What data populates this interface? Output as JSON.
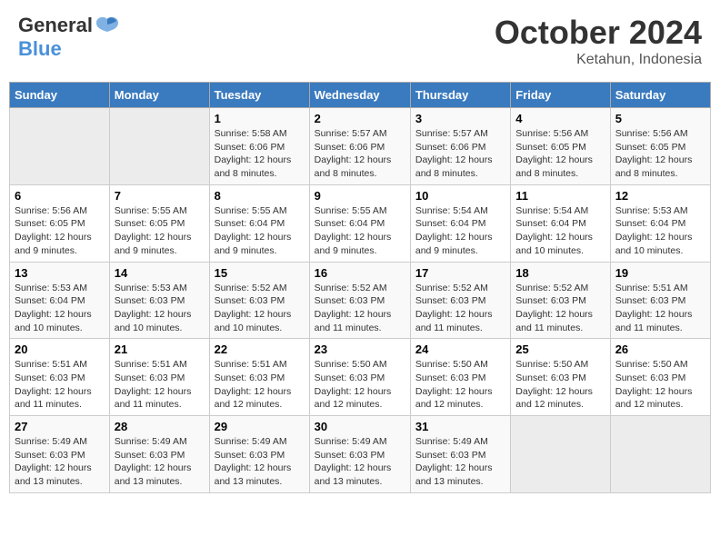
{
  "header": {
    "logo_general": "General",
    "logo_blue": "Blue",
    "month": "October 2024",
    "location": "Ketahun, Indonesia"
  },
  "weekdays": [
    "Sunday",
    "Monday",
    "Tuesday",
    "Wednesday",
    "Thursday",
    "Friday",
    "Saturday"
  ],
  "weeks": [
    [
      {
        "day": "",
        "sunrise": "",
        "sunset": "",
        "daylight": ""
      },
      {
        "day": "",
        "sunrise": "",
        "sunset": "",
        "daylight": ""
      },
      {
        "day": "1",
        "sunrise": "Sunrise: 5:58 AM",
        "sunset": "Sunset: 6:06 PM",
        "daylight": "Daylight: 12 hours and 8 minutes."
      },
      {
        "day": "2",
        "sunrise": "Sunrise: 5:57 AM",
        "sunset": "Sunset: 6:06 PM",
        "daylight": "Daylight: 12 hours and 8 minutes."
      },
      {
        "day": "3",
        "sunrise": "Sunrise: 5:57 AM",
        "sunset": "Sunset: 6:06 PM",
        "daylight": "Daylight: 12 hours and 8 minutes."
      },
      {
        "day": "4",
        "sunrise": "Sunrise: 5:56 AM",
        "sunset": "Sunset: 6:05 PM",
        "daylight": "Daylight: 12 hours and 8 minutes."
      },
      {
        "day": "5",
        "sunrise": "Sunrise: 5:56 AM",
        "sunset": "Sunset: 6:05 PM",
        "daylight": "Daylight: 12 hours and 8 minutes."
      }
    ],
    [
      {
        "day": "6",
        "sunrise": "Sunrise: 5:56 AM",
        "sunset": "Sunset: 6:05 PM",
        "daylight": "Daylight: 12 hours and 9 minutes."
      },
      {
        "day": "7",
        "sunrise": "Sunrise: 5:55 AM",
        "sunset": "Sunset: 6:05 PM",
        "daylight": "Daylight: 12 hours and 9 minutes."
      },
      {
        "day": "8",
        "sunrise": "Sunrise: 5:55 AM",
        "sunset": "Sunset: 6:04 PM",
        "daylight": "Daylight: 12 hours and 9 minutes."
      },
      {
        "day": "9",
        "sunrise": "Sunrise: 5:55 AM",
        "sunset": "Sunset: 6:04 PM",
        "daylight": "Daylight: 12 hours and 9 minutes."
      },
      {
        "day": "10",
        "sunrise": "Sunrise: 5:54 AM",
        "sunset": "Sunset: 6:04 PM",
        "daylight": "Daylight: 12 hours and 9 minutes."
      },
      {
        "day": "11",
        "sunrise": "Sunrise: 5:54 AM",
        "sunset": "Sunset: 6:04 PM",
        "daylight": "Daylight: 12 hours and 10 minutes."
      },
      {
        "day": "12",
        "sunrise": "Sunrise: 5:53 AM",
        "sunset": "Sunset: 6:04 PM",
        "daylight": "Daylight: 12 hours and 10 minutes."
      }
    ],
    [
      {
        "day": "13",
        "sunrise": "Sunrise: 5:53 AM",
        "sunset": "Sunset: 6:04 PM",
        "daylight": "Daylight: 12 hours and 10 minutes."
      },
      {
        "day": "14",
        "sunrise": "Sunrise: 5:53 AM",
        "sunset": "Sunset: 6:03 PM",
        "daylight": "Daylight: 12 hours and 10 minutes."
      },
      {
        "day": "15",
        "sunrise": "Sunrise: 5:52 AM",
        "sunset": "Sunset: 6:03 PM",
        "daylight": "Daylight: 12 hours and 10 minutes."
      },
      {
        "day": "16",
        "sunrise": "Sunrise: 5:52 AM",
        "sunset": "Sunset: 6:03 PM",
        "daylight": "Daylight: 12 hours and 11 minutes."
      },
      {
        "day": "17",
        "sunrise": "Sunrise: 5:52 AM",
        "sunset": "Sunset: 6:03 PM",
        "daylight": "Daylight: 12 hours and 11 minutes."
      },
      {
        "day": "18",
        "sunrise": "Sunrise: 5:52 AM",
        "sunset": "Sunset: 6:03 PM",
        "daylight": "Daylight: 12 hours and 11 minutes."
      },
      {
        "day": "19",
        "sunrise": "Sunrise: 5:51 AM",
        "sunset": "Sunset: 6:03 PM",
        "daylight": "Daylight: 12 hours and 11 minutes."
      }
    ],
    [
      {
        "day": "20",
        "sunrise": "Sunrise: 5:51 AM",
        "sunset": "Sunset: 6:03 PM",
        "daylight": "Daylight: 12 hours and 11 minutes."
      },
      {
        "day": "21",
        "sunrise": "Sunrise: 5:51 AM",
        "sunset": "Sunset: 6:03 PM",
        "daylight": "Daylight: 12 hours and 11 minutes."
      },
      {
        "day": "22",
        "sunrise": "Sunrise: 5:51 AM",
        "sunset": "Sunset: 6:03 PM",
        "daylight": "Daylight: 12 hours and 12 minutes."
      },
      {
        "day": "23",
        "sunrise": "Sunrise: 5:50 AM",
        "sunset": "Sunset: 6:03 PM",
        "daylight": "Daylight: 12 hours and 12 minutes."
      },
      {
        "day": "24",
        "sunrise": "Sunrise: 5:50 AM",
        "sunset": "Sunset: 6:03 PM",
        "daylight": "Daylight: 12 hours and 12 minutes."
      },
      {
        "day": "25",
        "sunrise": "Sunrise: 5:50 AM",
        "sunset": "Sunset: 6:03 PM",
        "daylight": "Daylight: 12 hours and 12 minutes."
      },
      {
        "day": "26",
        "sunrise": "Sunrise: 5:50 AM",
        "sunset": "Sunset: 6:03 PM",
        "daylight": "Daylight: 12 hours and 12 minutes."
      }
    ],
    [
      {
        "day": "27",
        "sunrise": "Sunrise: 5:49 AM",
        "sunset": "Sunset: 6:03 PM",
        "daylight": "Daylight: 12 hours and 13 minutes."
      },
      {
        "day": "28",
        "sunrise": "Sunrise: 5:49 AM",
        "sunset": "Sunset: 6:03 PM",
        "daylight": "Daylight: 12 hours and 13 minutes."
      },
      {
        "day": "29",
        "sunrise": "Sunrise: 5:49 AM",
        "sunset": "Sunset: 6:03 PM",
        "daylight": "Daylight: 12 hours and 13 minutes."
      },
      {
        "day": "30",
        "sunrise": "Sunrise: 5:49 AM",
        "sunset": "Sunset: 6:03 PM",
        "daylight": "Daylight: 12 hours and 13 minutes."
      },
      {
        "day": "31",
        "sunrise": "Sunrise: 5:49 AM",
        "sunset": "Sunset: 6:03 PM",
        "daylight": "Daylight: 12 hours and 13 minutes."
      },
      {
        "day": "",
        "sunrise": "",
        "sunset": "",
        "daylight": ""
      },
      {
        "day": "",
        "sunrise": "",
        "sunset": "",
        "daylight": ""
      }
    ]
  ]
}
